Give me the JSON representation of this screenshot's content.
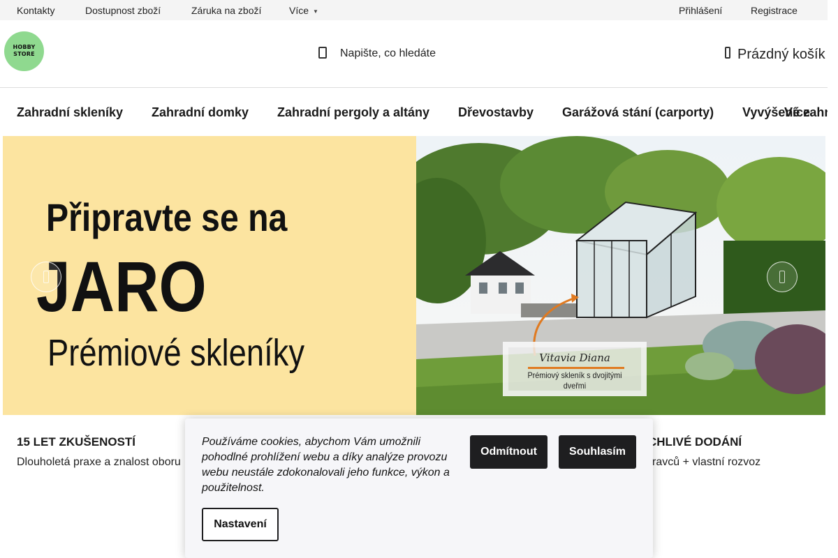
{
  "topbar": {
    "links": [
      "Kontakty",
      "Dostupnost zboží",
      "Záruka na zboží",
      "Více"
    ],
    "login": "Přihlášení",
    "register": "Registrace"
  },
  "header": {
    "logo_line1": "HOBBY",
    "logo_line2": "STORE",
    "logo_color": "#8fd98f",
    "search_placeholder": "Napište, co hledáte",
    "cart_label": "Prázdný košík"
  },
  "categories": [
    "Zahradní skleníky",
    "Zahradní domky",
    "Zahradní pergoly a altány",
    "Dřevostavby",
    "Garážová stání (carporty)",
    "Vyvýšené zahr",
    "Více"
  ],
  "hero": {
    "line1": "Připravte se na",
    "line2": "JARO",
    "line3": "Prémiové skleníky",
    "background": "#fce4a0",
    "product_name": "Vitavia Diana",
    "product_desc_line1": "Prémiový skleník s dvojitými",
    "product_desc_line2": "dveřmi"
  },
  "usps": [
    {
      "title": "15 LET ZKUŠENOSTÍ",
      "text": "Dlouholetá praxe a znalost oboru"
    },
    {
      "title": "CHLIVÉ DODÁNÍ",
      "text": "ravců + vlastní rozvoz"
    }
  ],
  "cookie": {
    "text": "Používáme cookies, abychom Vám umožnili pohodlné prohlížení webu a díky analýze provozu webu neustále zdokonalovali jeho funkce, výkon a použitelnost.",
    "decline": "Odmítnout",
    "accept": "Souhlasím",
    "settings": "Nastavení"
  }
}
